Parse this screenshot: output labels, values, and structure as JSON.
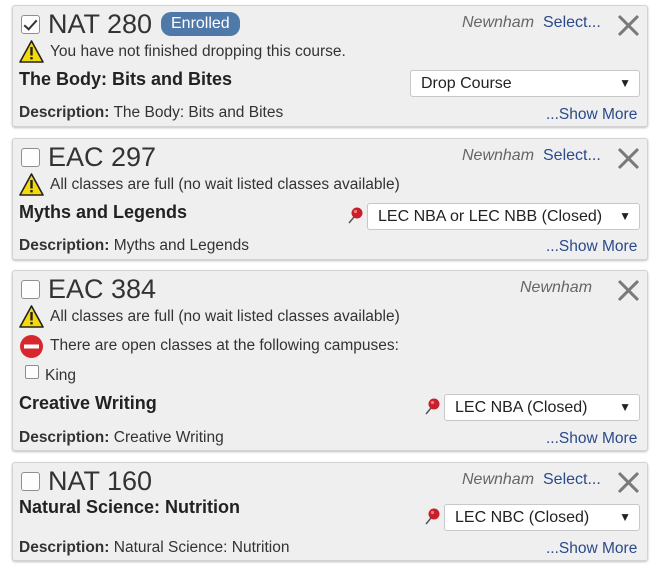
{
  "courses": [
    {
      "code": "NAT 280",
      "status_badge": "Enrolled",
      "campus": "Newnham",
      "select_link": "Select...",
      "messages": [
        "You have not finished dropping this course."
      ],
      "title": "The Body: Bits and Bites",
      "dropdown_value": "Drop Course",
      "description_label": "Description:",
      "description": "The Body: Bits and Bites",
      "show_more": "...Show More",
      "checked": true
    },
    {
      "code": "EAC 297",
      "campus": "Newnham",
      "select_link": "Select...",
      "messages": [
        "All classes are full (no wait listed classes available)"
      ],
      "title": "Myths and Legends",
      "dropdown_value": "LEC NBA or LEC NBB (Closed)",
      "description_label": "Description:",
      "description": "Myths and Legends",
      "show_more": "...Show More",
      "checked": false
    },
    {
      "code": "EAC 384",
      "campus": "Newnham",
      "messages": [
        "All classes are full (no wait listed classes available)",
        "There are open classes at the following campuses:"
      ],
      "open_campus_option": "King",
      "title": "Creative Writing",
      "dropdown_value": "LEC NBA (Closed)",
      "description_label": "Description:",
      "description": "Creative Writing",
      "show_more": "...Show More",
      "checked": false
    },
    {
      "code": "NAT 160",
      "campus": "Newnham",
      "select_link": "Select...",
      "title": "Natural Science: Nutrition",
      "dropdown_value": "LEC NBC (Closed)",
      "description_label": "Description:",
      "description": "Natural Science: Nutrition",
      "show_more": "...Show More",
      "checked": false
    }
  ],
  "icons": {
    "warning": "warning-icon",
    "blocked": "no-entry-icon",
    "pin": "pushpin-icon",
    "close": "close-icon",
    "dropdown_arrow": "caret-down-icon"
  },
  "colors": {
    "badge": "#4f79a8",
    "link": "#2a4a8a",
    "warning_yellow": "#f5d90a",
    "no_entry_red": "#d9262c",
    "pin_red": "#c8202a"
  }
}
